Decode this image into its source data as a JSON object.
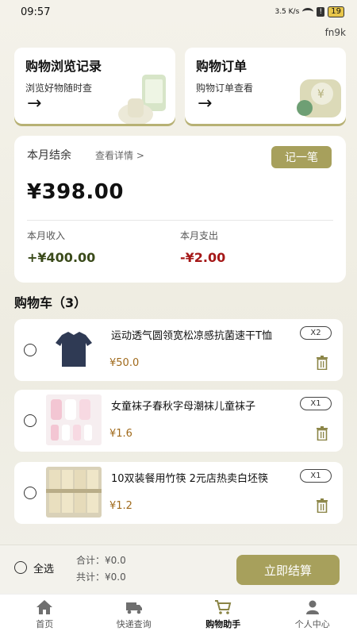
{
  "status_bar": {
    "time": "09:57",
    "network_speed": "3.5 K/s",
    "battery": "19"
  },
  "user_id": "fn9k",
  "quick_cards": [
    {
      "title": "购物浏览记录",
      "subtitle": "浏览好物随时查"
    },
    {
      "title": "购物订单",
      "subtitle": "购物订单查看"
    }
  ],
  "balance": {
    "title": "本月结余",
    "detail_link": "查看详情 >",
    "record_button": "记一笔",
    "amount": "¥398.00",
    "income_label": "本月收入",
    "income_value": "+¥400.00",
    "expense_label": "本月支出",
    "expense_value": "-¥2.00"
  },
  "cart": {
    "title": "购物车（3）",
    "items": [
      {
        "name": "运动透气圆领宽松凉感抗菌速干T恤",
        "price": "¥50.0",
        "qty": "X2"
      },
      {
        "name": "女童袜子春秋字母潮袜儿童袜子",
        "price": "¥1.6",
        "qty": "X1"
      },
      {
        "name": "10双装餐用竹筷 2元店热卖白坯筷",
        "price": "¥1.2",
        "qty": "X1"
      }
    ]
  },
  "checkout": {
    "select_all": "全选",
    "total": "合计：¥0.0",
    "count": "共计：¥0.0",
    "button": "立即结算"
  },
  "tabs": [
    {
      "label": "首页",
      "icon": "home-icon"
    },
    {
      "label": "快递查询",
      "icon": "truck-icon"
    },
    {
      "label": "购物助手",
      "icon": "cart-icon"
    },
    {
      "label": "个人中心",
      "icon": "person-icon"
    }
  ],
  "colors": {
    "accent": "#a7a05c",
    "expense": "#a51818",
    "price": "#a06a1c"
  }
}
